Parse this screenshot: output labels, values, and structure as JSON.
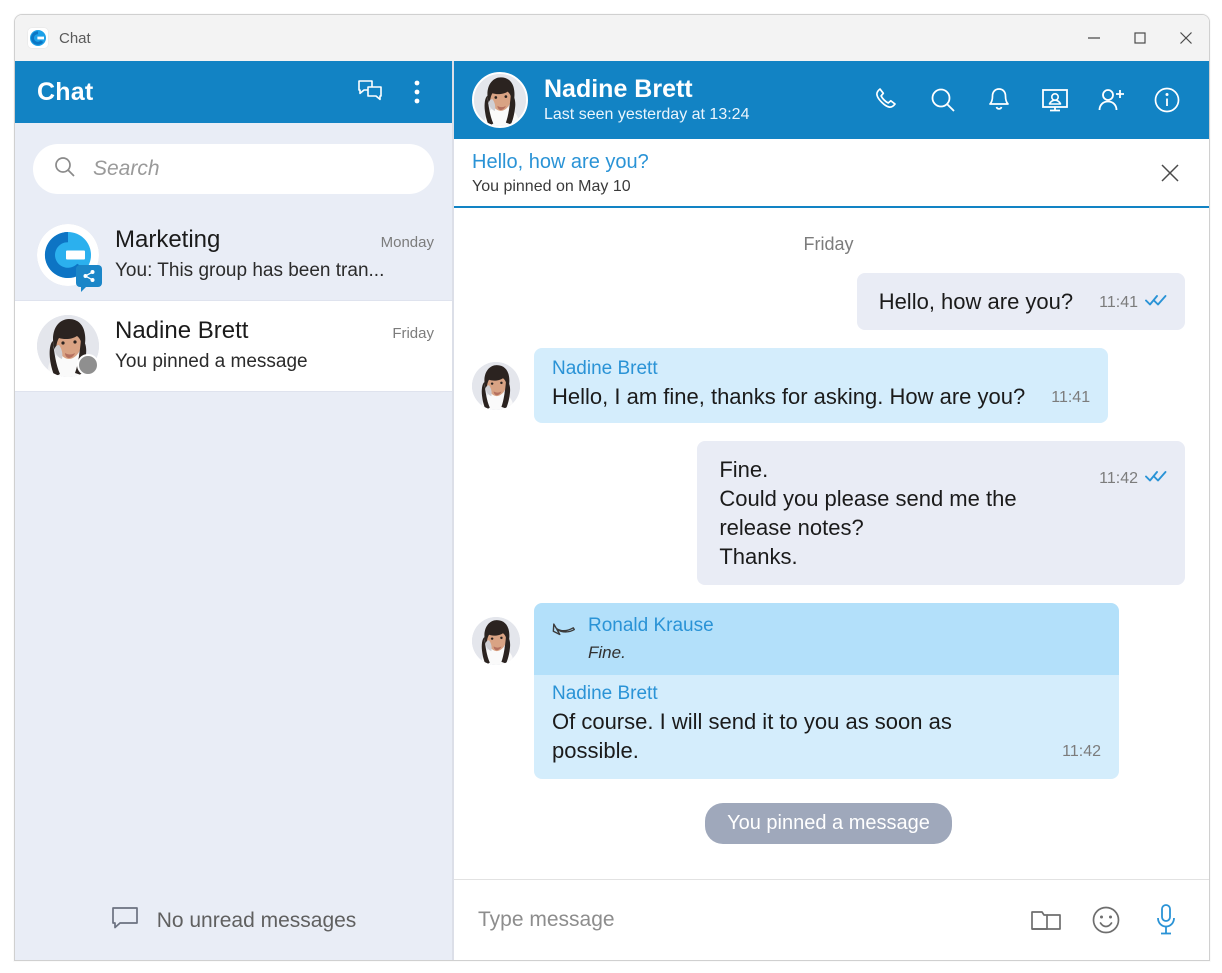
{
  "window": {
    "title": "Chat",
    "app_icon": "chat-app-icon",
    "controls": {
      "minimize": "minimize",
      "maximize": "maximize",
      "close": "close"
    }
  },
  "sidebar": {
    "title": "Chat",
    "actions": [
      {
        "name": "new-chat-icon",
        "label": "New chat"
      },
      {
        "name": "more-options-icon",
        "label": "More options"
      }
    ],
    "search": {
      "placeholder": "Search",
      "value": "",
      "icon": "search-icon"
    },
    "chats": [
      {
        "name": "Marketing",
        "time": "Monday",
        "snippet": "You: This group has been tran...",
        "avatar_type": "logo",
        "badge": "share-badge-icon",
        "active": false
      },
      {
        "name": "Nadine Brett",
        "time": "Friday",
        "snippet": "You pinned a message",
        "avatar_type": "photo",
        "presence": "offline",
        "active": true
      }
    ],
    "footer": {
      "icon": "message-bubble-icon",
      "text": "No unread messages"
    }
  },
  "conversation": {
    "header": {
      "name": "Nadine Brett",
      "status": "Last seen yesterday at 13:24",
      "avatar": "nadine-avatar",
      "actions": [
        {
          "name": "call-icon",
          "label": "Call"
        },
        {
          "name": "search-icon",
          "label": "Search"
        },
        {
          "name": "bell-icon",
          "label": "Notifications"
        },
        {
          "name": "screen-share-icon",
          "label": "Share screen"
        },
        {
          "name": "add-person-icon",
          "label": "Add person"
        },
        {
          "name": "info-icon",
          "label": "Info"
        }
      ]
    },
    "pinned": {
      "title": "Hello, how are you?",
      "subtitle": "You pinned on May 10",
      "close_icon": "close-icon"
    },
    "day_separator": "Friday",
    "messages": [
      {
        "direction": "out",
        "text": "Hello, how are you?",
        "time": "11:41",
        "status_icon": "double-check-icon",
        "layout": "inline"
      },
      {
        "direction": "in",
        "sender": "Nadine Brett",
        "text": "Hello, I am fine, thanks for asking. How are you?",
        "time": "11:41",
        "layout": "inline",
        "avatar": true
      },
      {
        "direction": "out",
        "text": "Fine.\nCould you please send me the release notes?\nThanks.",
        "time": "11:42",
        "status_icon": "double-check-icon",
        "layout": "block"
      },
      {
        "direction": "in",
        "sender": "Nadine Brett",
        "text": "Of course. I will send it to you as soon as possible.",
        "time": "11:42",
        "layout": "inline",
        "avatar": true,
        "quote": {
          "icon": "reply-arrow-icon",
          "name": "Ronald Krause",
          "text": "Fine."
        }
      }
    ],
    "system_pill": "You pinned a message",
    "composer": {
      "placeholder": "Type message",
      "value": "",
      "actions": [
        {
          "name": "attach-folder-icon",
          "label": "Attach file"
        },
        {
          "name": "emoji-icon",
          "label": "Emoji"
        },
        {
          "name": "microphone-icon",
          "label": "Voice message"
        }
      ]
    }
  },
  "colors": {
    "accent": "#1283c4",
    "link": "#2a93d6",
    "sidebar_bg": "#e9edf6",
    "bubble_out": "#e9ecf5",
    "bubble_in": "#d4edfc",
    "quote_bg": "#b3e0fa",
    "pill_bg": "#9fa8bb",
    "presence_offline": "#8f8f8f"
  }
}
